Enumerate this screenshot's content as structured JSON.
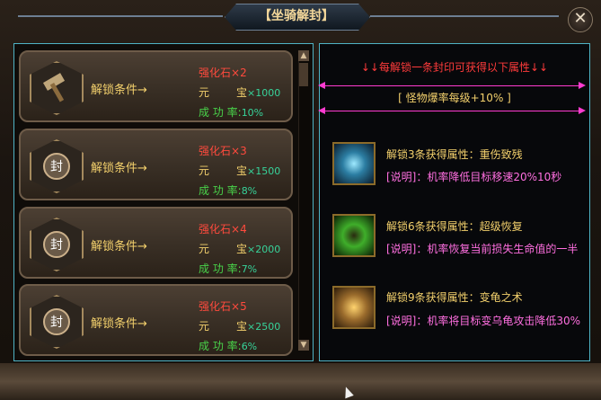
{
  "title": "【坐骑解封】",
  "close_label": "✕",
  "cards": [
    {
      "icon": "hammer-icon",
      "cond": "解锁条件→",
      "stone_label": "强化石",
      "stone_mul": "×2",
      "yuanbao_label1": "元",
      "yuanbao_label2": "宝",
      "yuanbao_val": "×1000",
      "rate_label": "成 功 率:",
      "rate_val": "10%"
    },
    {
      "icon": "seal-icon",
      "cond": "解锁条件→",
      "stone_label": "强化石",
      "stone_mul": "×3",
      "yuanbao_label1": "元",
      "yuanbao_label2": "宝",
      "yuanbao_val": "×1500",
      "rate_label": "成 功 率:",
      "rate_val": "8%"
    },
    {
      "icon": "seal-icon",
      "cond": "解锁条件→",
      "stone_label": "强化石",
      "stone_mul": "×4",
      "yuanbao_label1": "元",
      "yuanbao_label2": "宝",
      "yuanbao_val": "×2000",
      "rate_label": "成 功 率:",
      "rate_val": "7%"
    },
    {
      "icon": "seal-icon",
      "cond": "解锁条件→",
      "stone_label": "强化石",
      "stone_mul": "×5",
      "yuanbao_label1": "元",
      "yuanbao_label2": "宝",
      "yuanbao_val": "×2500",
      "rate_label": "成 功 率:",
      "rate_val": "6%"
    }
  ],
  "right": {
    "header": "↓↓每解锁一条封印可获得以下属性↓↓",
    "attr": "[   怪物爆率每级+10%   ]",
    "bonuses": [
      {
        "title": "解锁3条获得属性：重伤致残",
        "desc": "[说明]：机率降低目标移速20%10秒",
        "icon": "crystal-icon"
      },
      {
        "title": "解锁6条获得属性：超级恢复",
        "desc": "[说明]：机率恢复当前损失生命值的一半",
        "icon": "recovery-icon"
      },
      {
        "title": "解锁9条获得属性：变龟之术",
        "desc": "[说明]：机率将目标变乌龟攻击降低30%",
        "icon": "turtle-icon"
      }
    ]
  },
  "colors": {
    "accent": "#4fb3c5",
    "gold": "#f3d06c",
    "red": "#ff4a3d",
    "green": "#49d24a",
    "pink": "#ff6fe0"
  }
}
